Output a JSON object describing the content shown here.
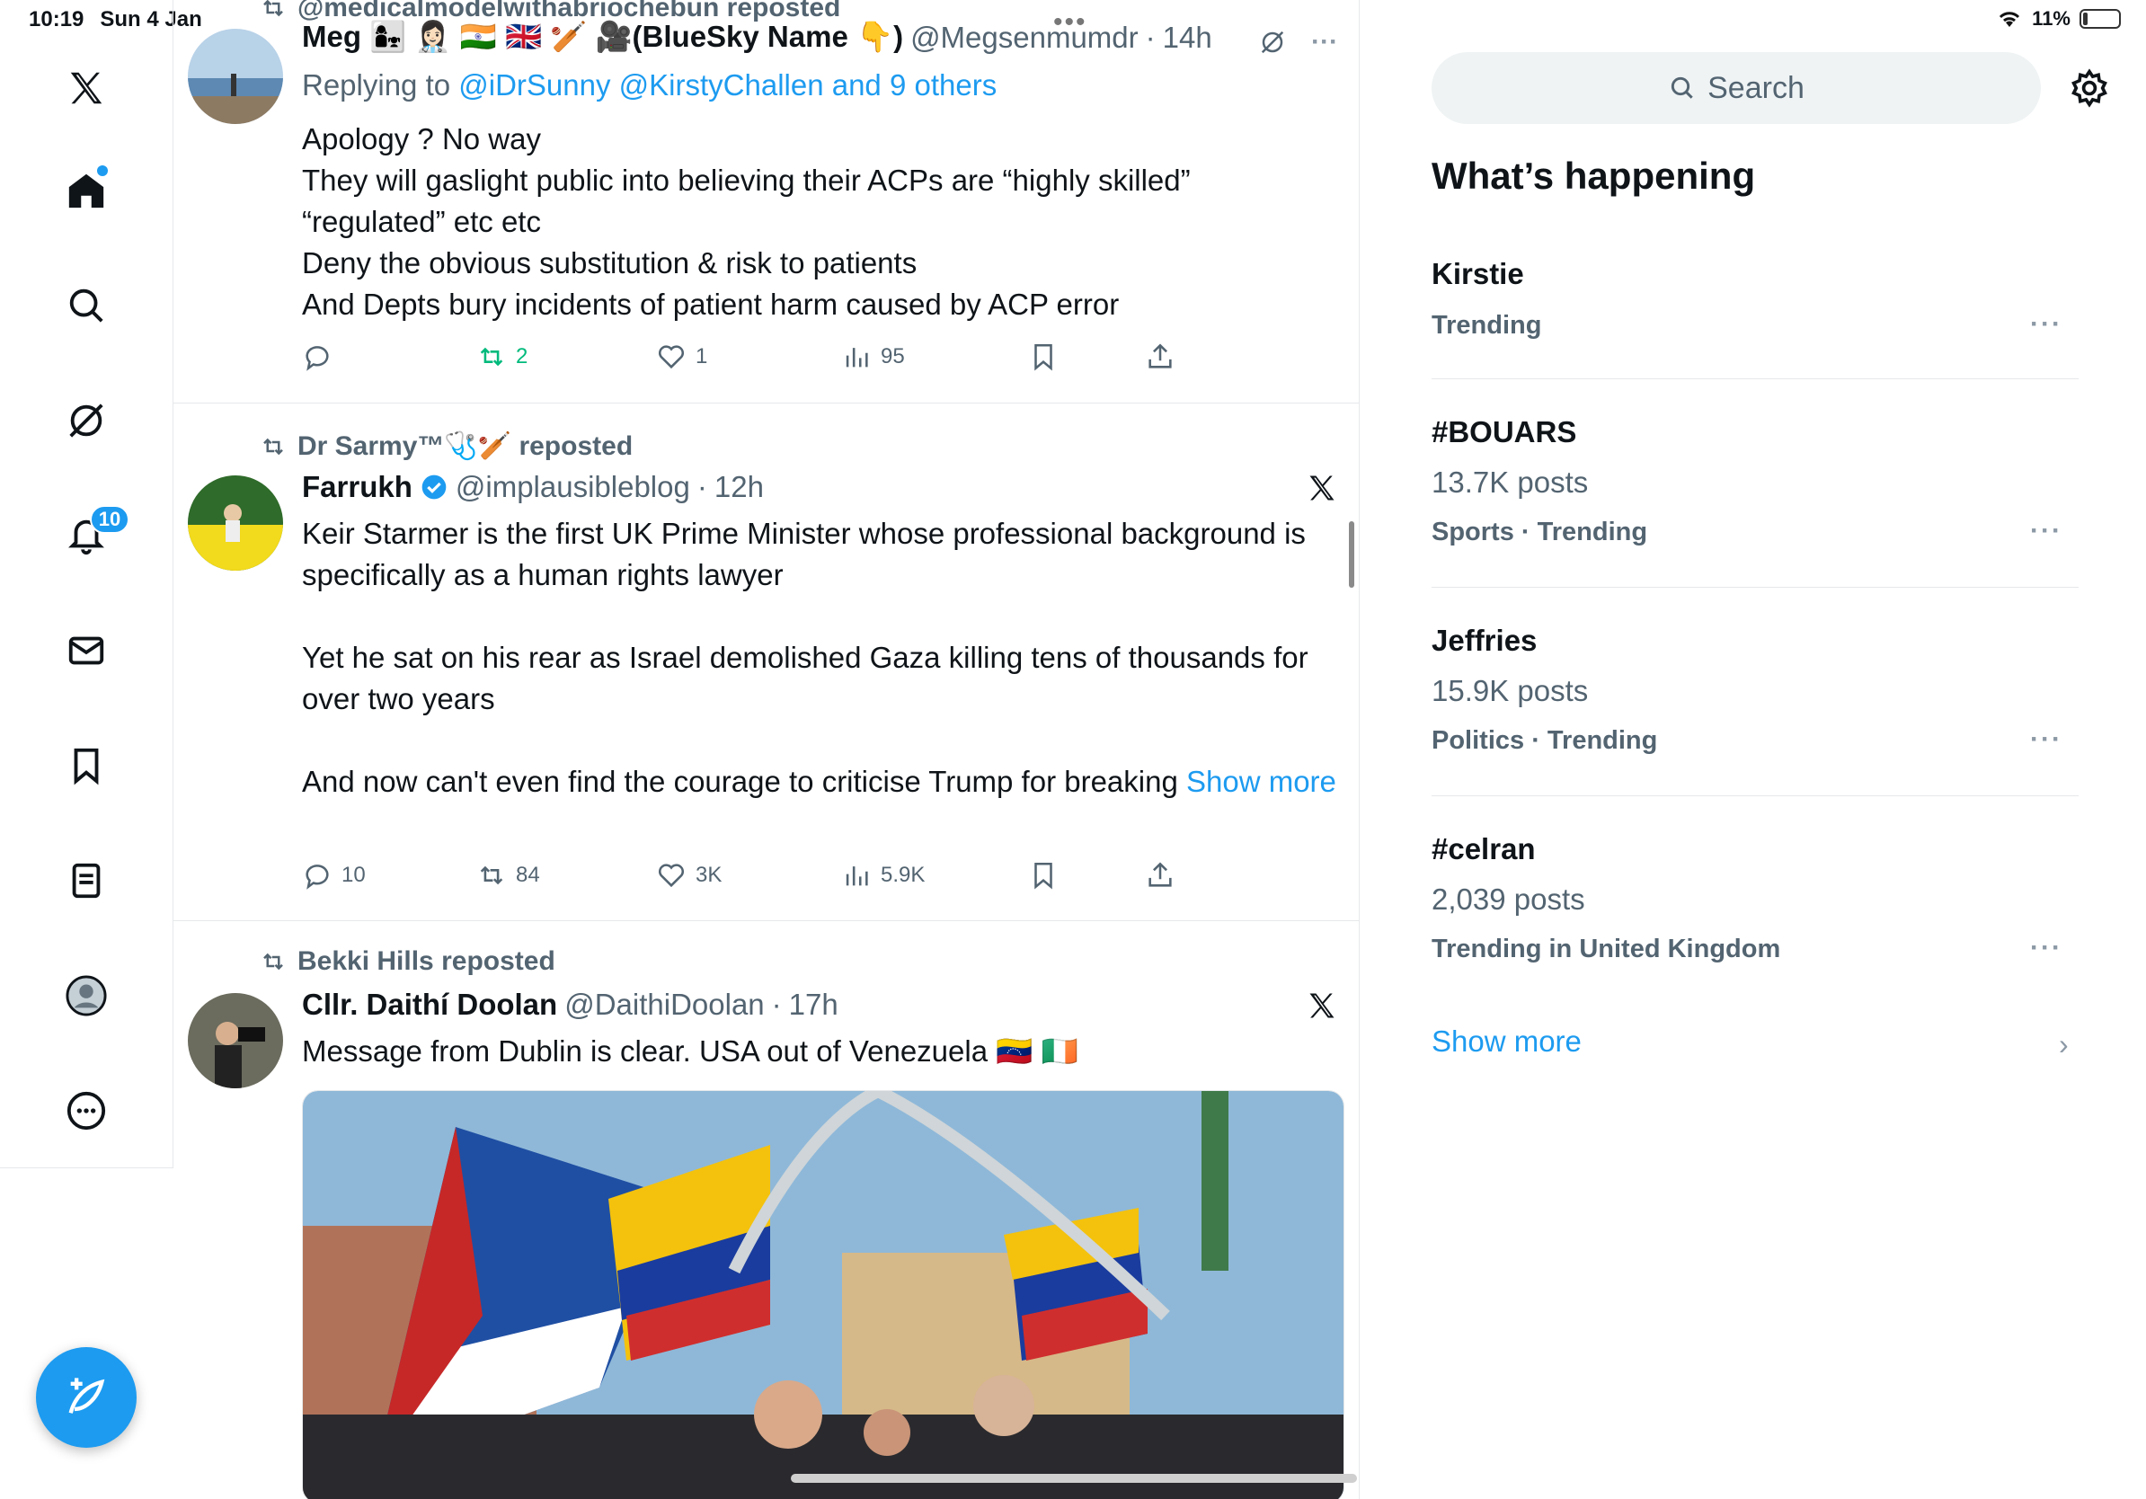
{
  "status_bar": {
    "time": "10:19",
    "date": "Sun 4 Jan",
    "battery": "11%",
    "top_dots": "•••"
  },
  "nav": {
    "notifications_badge": "10"
  },
  "feed": {
    "post1": {
      "repost_line": "@medicalmodelwithabriochebun reposted",
      "name": "Meg 👩‍👧 👩🏻‍⚕️ 🇮🇳 🇬🇧 🏏 🎥(BlueSky Name 👇)",
      "handle": "@Megsenmumdr",
      "time": "14h",
      "reply_prefix": "Replying to ",
      "reply_to": "@iDrSunny @KirstyChallen and 9 others",
      "lines": [
        "Apology ? No way",
        "They will gaslight public into believing their ACPs are “highly skilled”",
        "“regulated” etc etc",
        "Deny the obvious substitution & risk to patients",
        "And Depts bury incidents of patient harm caused by ACP error"
      ],
      "reposts": "2",
      "likes": "1",
      "views": "95",
      "more": "···"
    },
    "post2": {
      "repost_line": "Dr Sarmy™🩺🏏 reposted",
      "name": "Farrukh",
      "handle": "@implausibleblog",
      "time": "12h",
      "para1": "Keir Starmer is the first UK Prime Minister whose professional background is specifically as a human rights lawyer",
      "para2": "Yet he sat on his rear as Israel demolished Gaza killing tens of thousands for over two years",
      "para3": "And now can't even find the courage to criticise Trump for breaking ",
      "show_more": "Show more",
      "replies": "10",
      "reposts": "84",
      "likes": "3K",
      "views": "5.9K"
    },
    "post3": {
      "repost_line": "Bekki Hills reposted",
      "name": "Cllr. Daithí Doolan",
      "handle": "@DaithiDoolan",
      "time": "17h",
      "text": "Message from Dublin is clear. USA out of Venezuela 🇻🇪 🇮🇪"
    }
  },
  "sidebar": {
    "search_placeholder": "Search",
    "title": "What’s happening",
    "trends": [
      {
        "title": "Kirstie",
        "count": "",
        "meta": "Trending"
      },
      {
        "title": "#BOUARS",
        "count": "13.7K posts",
        "meta": "Sports · Trending"
      },
      {
        "title": "Jeffries",
        "count": "15.9K posts",
        "meta": "Politics · Trending"
      },
      {
        "title": "#celran",
        "count": "2,039 posts",
        "meta": "Trending in United Kingdom"
      }
    ],
    "trend_more": "···",
    "show_more": "Show more",
    "chevron": "›"
  }
}
